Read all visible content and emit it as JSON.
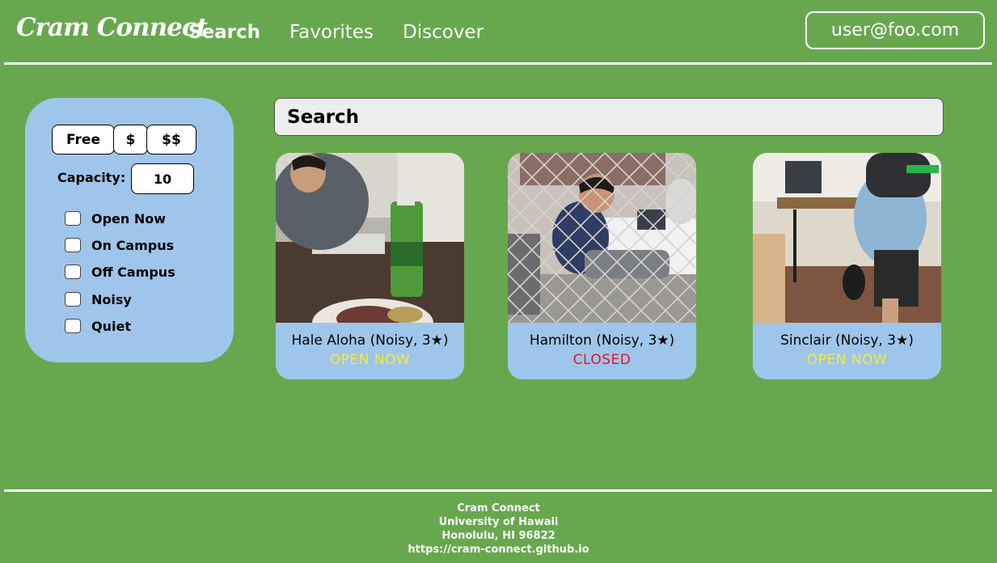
{
  "header": {
    "brand": "Cram Connect",
    "nav": [
      "Search",
      "Favorites",
      "Discover"
    ],
    "user": "user@foo.com"
  },
  "filters": {
    "price_options": [
      "Free",
      "$",
      "$$"
    ],
    "capacity_label": "Capacity:",
    "capacity_value": "10",
    "checkboxes": [
      "Open Now",
      "On Campus",
      "Off Campus",
      "Noisy",
      "Quiet"
    ]
  },
  "search": {
    "placeholder": "Search"
  },
  "cards": [
    {
      "title": "Hale Aloha (Noisy, 3★)",
      "status": "OPEN NOW"
    },
    {
      "title": "Hamilton (Noisy, 3★)",
      "status": "CLOSED"
    },
    {
      "title": "Sinclair (Noisy, 3★)",
      "status": "OPEN NOW"
    }
  ],
  "colors": {
    "background": "#67a84e",
    "panel": "#a0c5eb",
    "open": "#f2ea3a",
    "closed": "#e0142a"
  },
  "footer": {
    "lines": [
      "Cram Connect",
      "University of Hawaii",
      "Honolulu, HI 96822",
      "https://cram-connect.github.io"
    ]
  }
}
